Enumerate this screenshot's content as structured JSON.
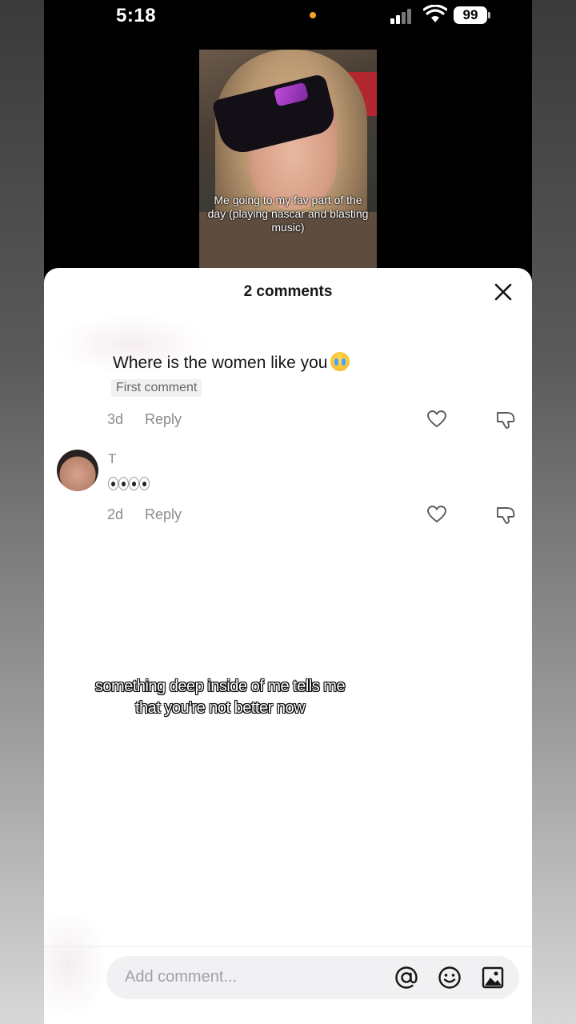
{
  "status_bar": {
    "time": "5:18",
    "battery": "99",
    "dot_color": "#f5a623"
  },
  "video": {
    "caption": "Me going to my fav part of the day (playing nascar and blasting music)"
  },
  "comments_sheet": {
    "title": "2 comments",
    "comments": [
      {
        "text": "Where is the women like you",
        "emoji": "loudly-crying-face",
        "badge": "First comment",
        "age": "3d",
        "reply_label": "Reply"
      },
      {
        "username": "T",
        "emoji": "eyes x2",
        "age": "2d",
        "reply_label": "Reply"
      }
    ]
  },
  "lyric_overlay": "something deep inside of me tells me that you're not better now",
  "input": {
    "placeholder": "Add comment..."
  },
  "icons": {
    "close": "close-icon",
    "like": "heart-icon",
    "dislike": "thumbs-down-icon",
    "mention": "at-sign-icon",
    "emoji": "smiley-icon",
    "image": "image-icon"
  }
}
